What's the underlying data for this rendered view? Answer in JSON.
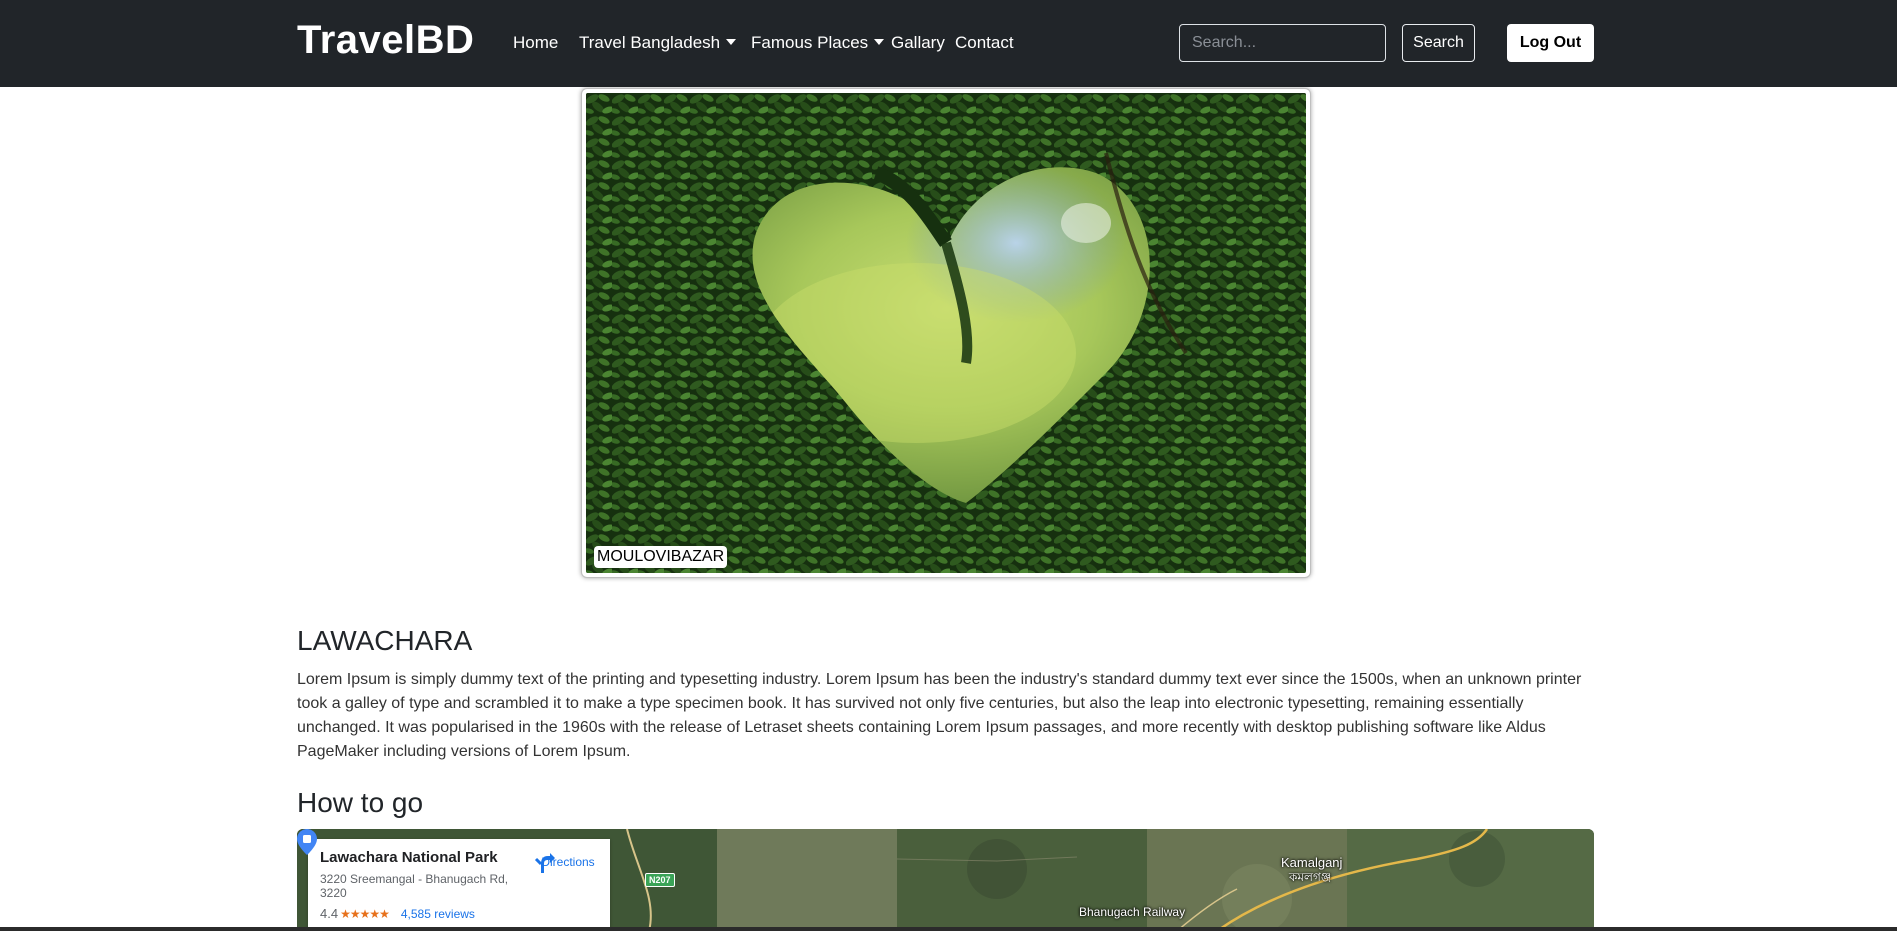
{
  "navbar": {
    "brand": "TravelBD",
    "links": {
      "home": "Home",
      "travel_bangladesh": "Travel Bangladesh",
      "famous_places": "Famous Places",
      "gallary": "Gallary",
      "contact": "Contact"
    },
    "search_placeholder": "Search...",
    "search_label": "Search",
    "logout_label": "Log Out"
  },
  "hero": {
    "caption": "MOULOVIBAZAR",
    "image_icon": "heart-shaped-hedge-photo"
  },
  "article": {
    "title": "LAWACHARA",
    "body": "Lorem Ipsum is simply dummy text of the printing and typesetting industry. Lorem Ipsum has been the industry's standard dummy text ever since the 1500s, when an unknown printer took a galley of type and scrambled it to make a type specimen book. It has survived not only five centuries, but also the leap into electronic typesetting, remaining essentially unchanged. It was popularised in the 1960s with the release of Letraset sheets containing Lorem Ipsum passages, and more recently with desktop publishing software like Aldus PageMaker including versions of Lorem Ipsum."
  },
  "how_to_go": {
    "title": "How to go",
    "map": {
      "place_name": "Lawachara National Park",
      "address": "3220 Sreemangal - Bhanugach Rd, 3220",
      "rating": "4.4",
      "stars": "★★★★★",
      "reviews": "4,585 reviews",
      "directions_label": "Directions",
      "labels": {
        "road": "N207",
        "town_en": "Kamalganj",
        "town_bn": "কমলগঞ্জ",
        "railway": "Bhanugach Railway"
      }
    }
  },
  "colors": {
    "navbar_bg": "#212529",
    "link_blue": "#1a73e8",
    "star_orange": "#e7711b"
  }
}
